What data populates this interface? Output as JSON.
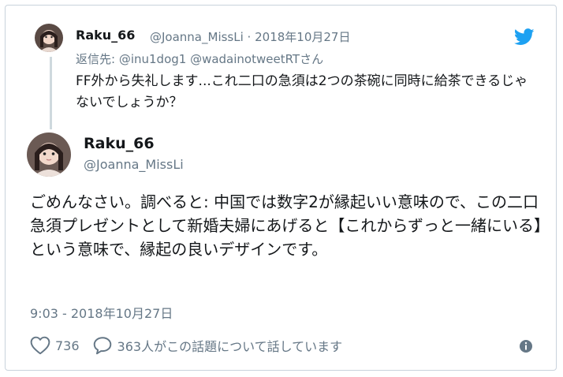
{
  "quoted_tweet": {
    "display_name": "Raku_66",
    "handle": "@Joanna_MissLi",
    "separator": "·",
    "date": "2018年10月27日",
    "reply_to": "返信先: @inu1dog1 @wadainotweetRTさん",
    "text": "FF外から失礼します...これ二口の急須は2つの茶碗に同時に給茶できるじゃないでしょうか？"
  },
  "main_tweet": {
    "display_name": "Raku_66",
    "handle": "@Joanna_MissLi",
    "text": "ごめんなさい。調べると: 中国では数字2が縁起いい意味ので、この二口急須プレゼントとして新婚夫婦にあげると【これからずっと一緒にいる】という意味で、縁起の良いデザインです。",
    "timestamp": "9:03 - 2018年10月27日"
  },
  "actions": {
    "like_count": "736",
    "comment_text": "363人がこの話題について話しています"
  },
  "icons": {
    "brand": "twitter-bird-icon",
    "like": "heart-icon",
    "comment": "speech-bubble-icon",
    "info": "info-icon"
  },
  "colors": {
    "twitter_blue": "#1da1f2",
    "secondary_text": "#657786",
    "primary_text": "#14171a",
    "border": "#c9d3dc"
  }
}
